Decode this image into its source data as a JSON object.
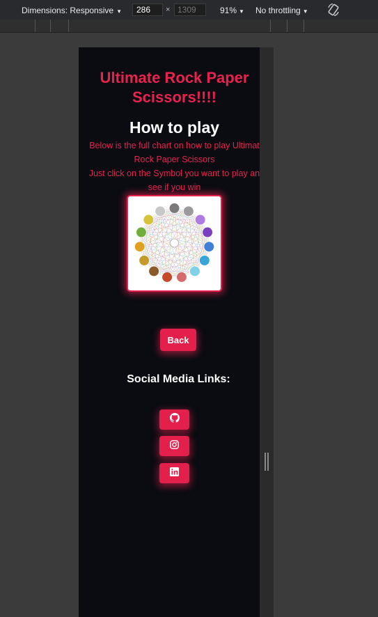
{
  "devtools": {
    "dimensions_label": "Dimensions: Responsive",
    "width": "286",
    "times": "×",
    "height": "1309",
    "zoom": "91%",
    "throttling": "No throttling"
  },
  "page": {
    "title": "Ultimate Rock Paper Scissors!!!!",
    "how_to_play": "How to play",
    "desc_lines": [
      "Below is the full chart on how to play Ultimat",
      "Rock Paper Scissors",
      "Just click on the Symbol you want to play an",
      "see if you win"
    ],
    "back_label": "Back",
    "social_title": "Social Media Links:",
    "social_icons": [
      "github-icon",
      "instagram-icon",
      "linkedin-icon"
    ],
    "colors": {
      "accent": "#e31f4c",
      "background": "#0a0c12"
    }
  }
}
